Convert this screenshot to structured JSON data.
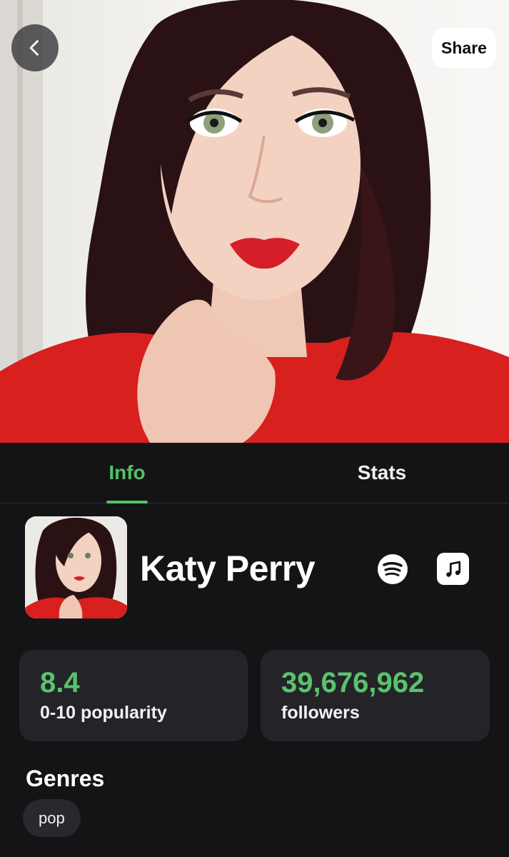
{
  "header": {
    "share_label": "Share",
    "back_icon": "chevron-left-icon"
  },
  "tabs": [
    {
      "label": "Info",
      "active": true
    },
    {
      "label": "Stats",
      "active": false
    }
  ],
  "artist": {
    "name": "Katy Perry",
    "links": [
      "spotify-icon",
      "apple-music-icon"
    ]
  },
  "stats": {
    "popularity_value": "8.4",
    "popularity_label": "0-10 popularity",
    "followers_value": "39,676,962",
    "followers_label": "followers"
  },
  "genres": {
    "heading": "Genres",
    "items": [
      "pop"
    ]
  },
  "colors": {
    "accent": "#54c06a",
    "background": "#141416",
    "card": "#242428"
  }
}
